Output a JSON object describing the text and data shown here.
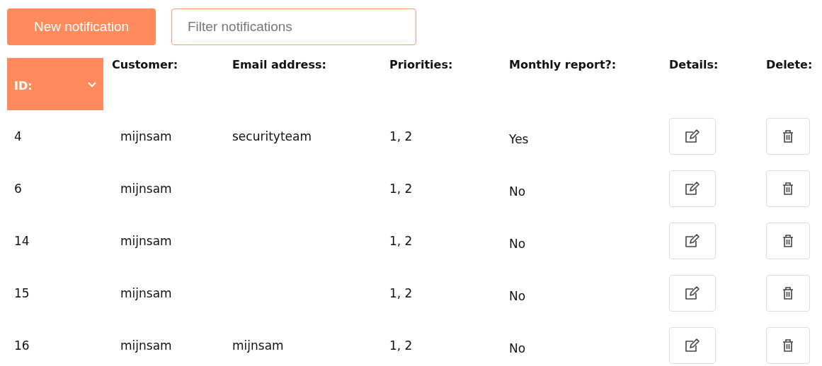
{
  "toolbar": {
    "new_button": "New notification",
    "filter": {
      "placeholder": "Filter notifications"
    }
  },
  "table": {
    "columns": [
      {
        "label": "ID:",
        "sorted": true
      },
      {
        "label": "Customer:",
        "sorted": false
      },
      {
        "label": "Email address:",
        "sorted": false
      },
      {
        "label": "Priorities:",
        "sorted": false
      },
      {
        "label": "Monthly report?:",
        "sorted": false
      },
      {
        "label": "Details:",
        "sorted": false
      },
      {
        "label": "Delete:",
        "sorted": false
      }
    ],
    "rows": [
      {
        "id": "4",
        "customer": "mijnsam",
        "email": "securityteam",
        "priorities": "1, 2",
        "monthly_report": "Yes"
      },
      {
        "id": "6",
        "customer": "mijnsam",
        "email": "",
        "priorities": "1, 2",
        "monthly_report": "No"
      },
      {
        "id": "14",
        "customer": "mijnsam",
        "email": "",
        "priorities": "1, 2",
        "monthly_report": "No"
      },
      {
        "id": "15",
        "customer": "mijnsam",
        "email": "",
        "priorities": "1, 2",
        "monthly_report": "No"
      },
      {
        "id": "16",
        "customer": "mijnsam",
        "email": "mijnsam",
        "priorities": "1, 2",
        "monthly_report": "No"
      }
    ]
  }
}
